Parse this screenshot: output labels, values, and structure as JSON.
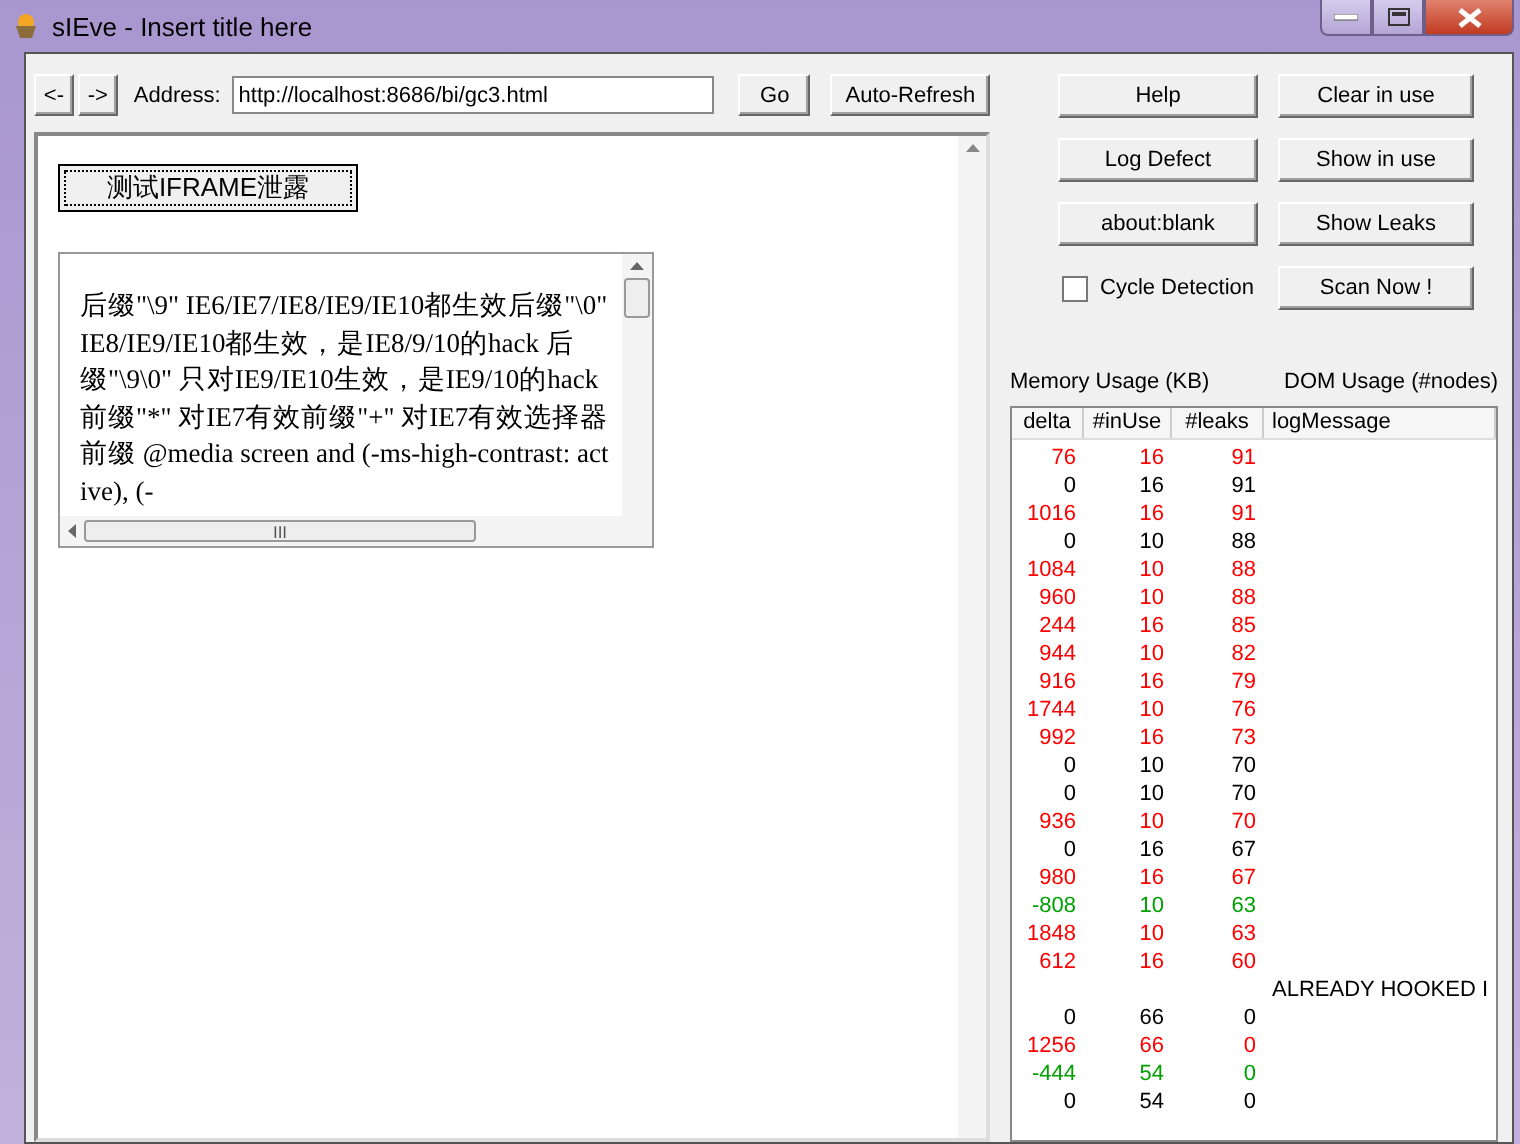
{
  "window": {
    "title": "sIEve - Insert title here"
  },
  "nav": {
    "back": "<-",
    "forward": "->",
    "address_label": "Address:",
    "address": "http://localhost:8686/bi/gc3.html",
    "go": "Go",
    "auto_refresh": "Auto-Refresh"
  },
  "page": {
    "button": "测试IFRAME泄露",
    "frame_text": "后缀\"\\9\" IE6/IE7/IE8/IE9/IE10都生效后缀\"\\0\" IE8/IE9/IE10都生效，是IE8/9/10的hack 后缀\"\\9\\0\" 只对IE9/IE10生效，是IE9/10的hack 前缀\"*\" 对IE7有效前缀\"+\" 对IE7有效选择器前缀  @media screen and (-ms-high-contrast: active), (-",
    "scroll_thumb": "III"
  },
  "actions": [
    {
      "label": "Help"
    },
    {
      "label": "Clear in use"
    },
    {
      "label": "Log Defect"
    },
    {
      "label": "Show in use"
    },
    {
      "label": "about:blank"
    },
    {
      "label": "Show Leaks"
    }
  ],
  "cycle_detection": {
    "label": "Cycle Detection",
    "checked": false
  },
  "scan_button": "Scan Now !",
  "memory_label": "Memory Usage (KB)",
  "dom_label": "DOM Usage (#nodes)",
  "table": {
    "columns": [
      "delta",
      "#inUse",
      "#leaks",
      "logMessage"
    ],
    "rows": [
      {
        "cells": [
          "76",
          "16",
          "91",
          ""
        ],
        "color": "#ff0000"
      },
      {
        "cells": [
          "0",
          "16",
          "91",
          ""
        ],
        "color": "#000000"
      },
      {
        "cells": [
          "1016",
          "16",
          "91",
          ""
        ],
        "color": "#ff0000"
      },
      {
        "cells": [
          "0",
          "10",
          "88",
          ""
        ],
        "color": "#000000"
      },
      {
        "cells": [
          "1084",
          "10",
          "88",
          ""
        ],
        "color": "#ff0000"
      },
      {
        "cells": [
          "960",
          "10",
          "88",
          ""
        ],
        "color": "#ff0000"
      },
      {
        "cells": [
          "244",
          "16",
          "85",
          ""
        ],
        "color": "#ff0000"
      },
      {
        "cells": [
          "944",
          "10",
          "82",
          ""
        ],
        "color": "#ff0000"
      },
      {
        "cells": [
          "916",
          "16",
          "79",
          ""
        ],
        "color": "#ff0000"
      },
      {
        "cells": [
          "1744",
          "10",
          "76",
          ""
        ],
        "color": "#ff0000"
      },
      {
        "cells": [
          "992",
          "16",
          "73",
          ""
        ],
        "color": "#ff0000"
      },
      {
        "cells": [
          "0",
          "10",
          "70",
          ""
        ],
        "color": "#000000"
      },
      {
        "cells": [
          "0",
          "10",
          "70",
          ""
        ],
        "color": "#000000"
      },
      {
        "cells": [
          "936",
          "10",
          "70",
          ""
        ],
        "color": "#ff0000"
      },
      {
        "cells": [
          "0",
          "16",
          "67",
          ""
        ],
        "color": "#000000"
      },
      {
        "cells": [
          "980",
          "16",
          "67",
          ""
        ],
        "color": "#ff0000"
      },
      {
        "cells": [
          "-808",
          "10",
          "63",
          ""
        ],
        "color": "#00a000"
      },
      {
        "cells": [
          "1848",
          "10",
          "63",
          ""
        ],
        "color": "#ff0000"
      },
      {
        "cells": [
          "612",
          "16",
          "60",
          ""
        ],
        "color": "#ff0000"
      },
      {
        "cells": [
          "",
          "",
          "",
          "ALREADY HOOKED I"
        ],
        "color": "#000000"
      },
      {
        "cells": [
          "0",
          "66",
          "0",
          ""
        ],
        "color": "#000000"
      },
      {
        "cells": [
          "1256",
          "66",
          "0",
          ""
        ],
        "color": "#ff0000"
      },
      {
        "cells": [
          "-444",
          "54",
          "0",
          ""
        ],
        "color": "#00a000"
      },
      {
        "cells": [
          "0",
          "54",
          "0",
          ""
        ],
        "color": "#000000"
      }
    ]
  }
}
